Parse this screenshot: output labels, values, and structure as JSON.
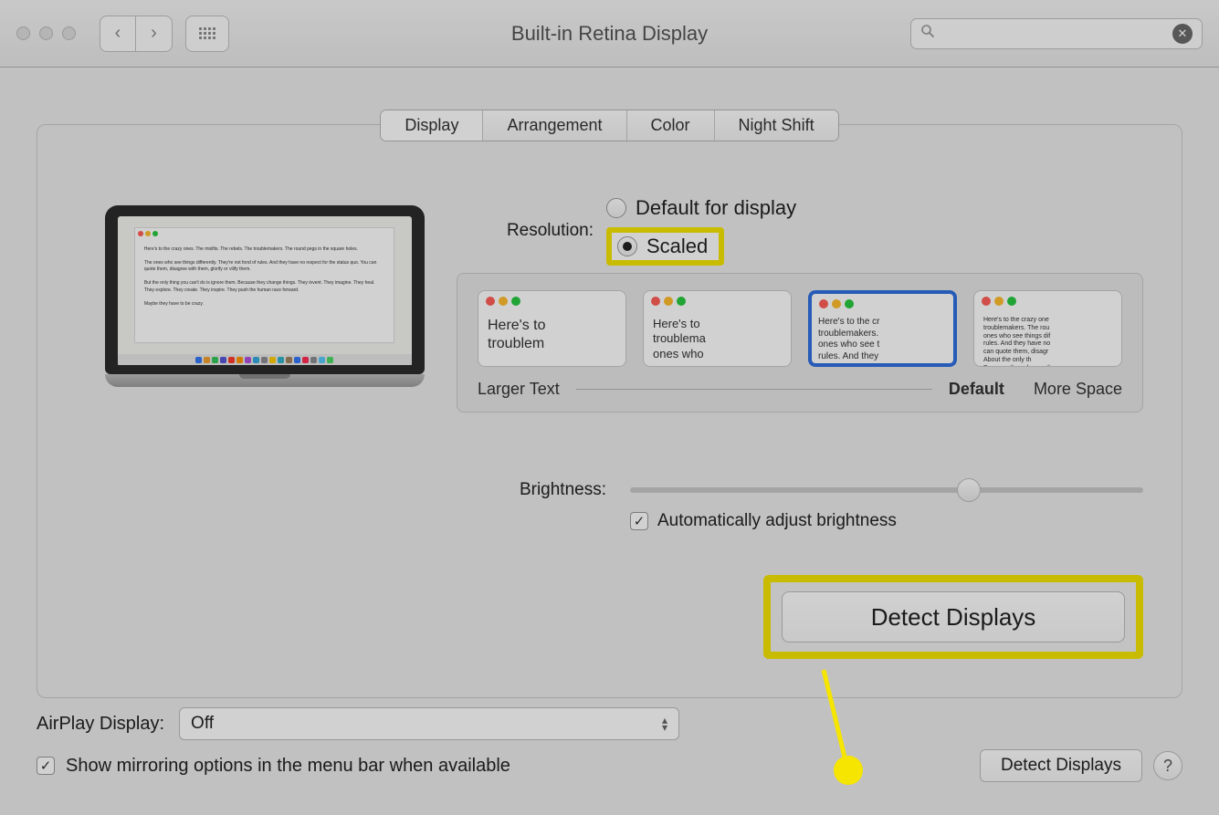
{
  "window": {
    "title": "Built-in Retina Display"
  },
  "tabs": [
    {
      "label": "Display",
      "active": true
    },
    {
      "label": "Arrangement",
      "active": false
    },
    {
      "label": "Color",
      "active": false
    },
    {
      "label": "Night Shift",
      "active": false
    }
  ],
  "resolution": {
    "label": "Resolution:",
    "options": {
      "default": "Default for display",
      "scaled": "Scaled"
    },
    "selected": "scaled",
    "scale_labels": {
      "larger": "Larger Text",
      "default": "Default",
      "more": "More Space"
    },
    "scale_selected_index": 2,
    "thumb_texts": [
      "Here's to\ntroublem",
      "Here's to\ntroublema\nones who",
      "Here's to the cr\ntroublemakers.\nones who see t\nrules. And they",
      "Here's to the crazy one\ntroublemakers. The rou\nones who see things dif\nrules. And they have no\ncan quote them, disagr\nAbout the only th\nBecause they change th"
    ]
  },
  "brightness": {
    "label": "Brightness:",
    "value_percent": 66,
    "auto_label": "Automatically adjust brightness",
    "auto_checked": true
  },
  "buttons": {
    "detect_big": "Detect Displays",
    "detect_small": "Detect Displays"
  },
  "airplay": {
    "label": "AirPlay Display:",
    "value": "Off"
  },
  "mirroring": {
    "label": "Show mirroring options in the menu bar when available",
    "checked": true
  },
  "mac_doc_text": "Here's to the crazy ones. The misfits. The rebels. The troublemakers. The round pegs in the square holes.\n\nThe ones who see things differently. They're not fond of rules. And they have no respect for the status quo. You can quote them, disagree with them, glorify or vilify them.\n\nBut the only thing you can't do is ignore them. Because they change things. They invent. They imagine. They heal. They explore. They create. They inspire. They push the human race forward.\n\nMaybe they have to be crazy."
}
